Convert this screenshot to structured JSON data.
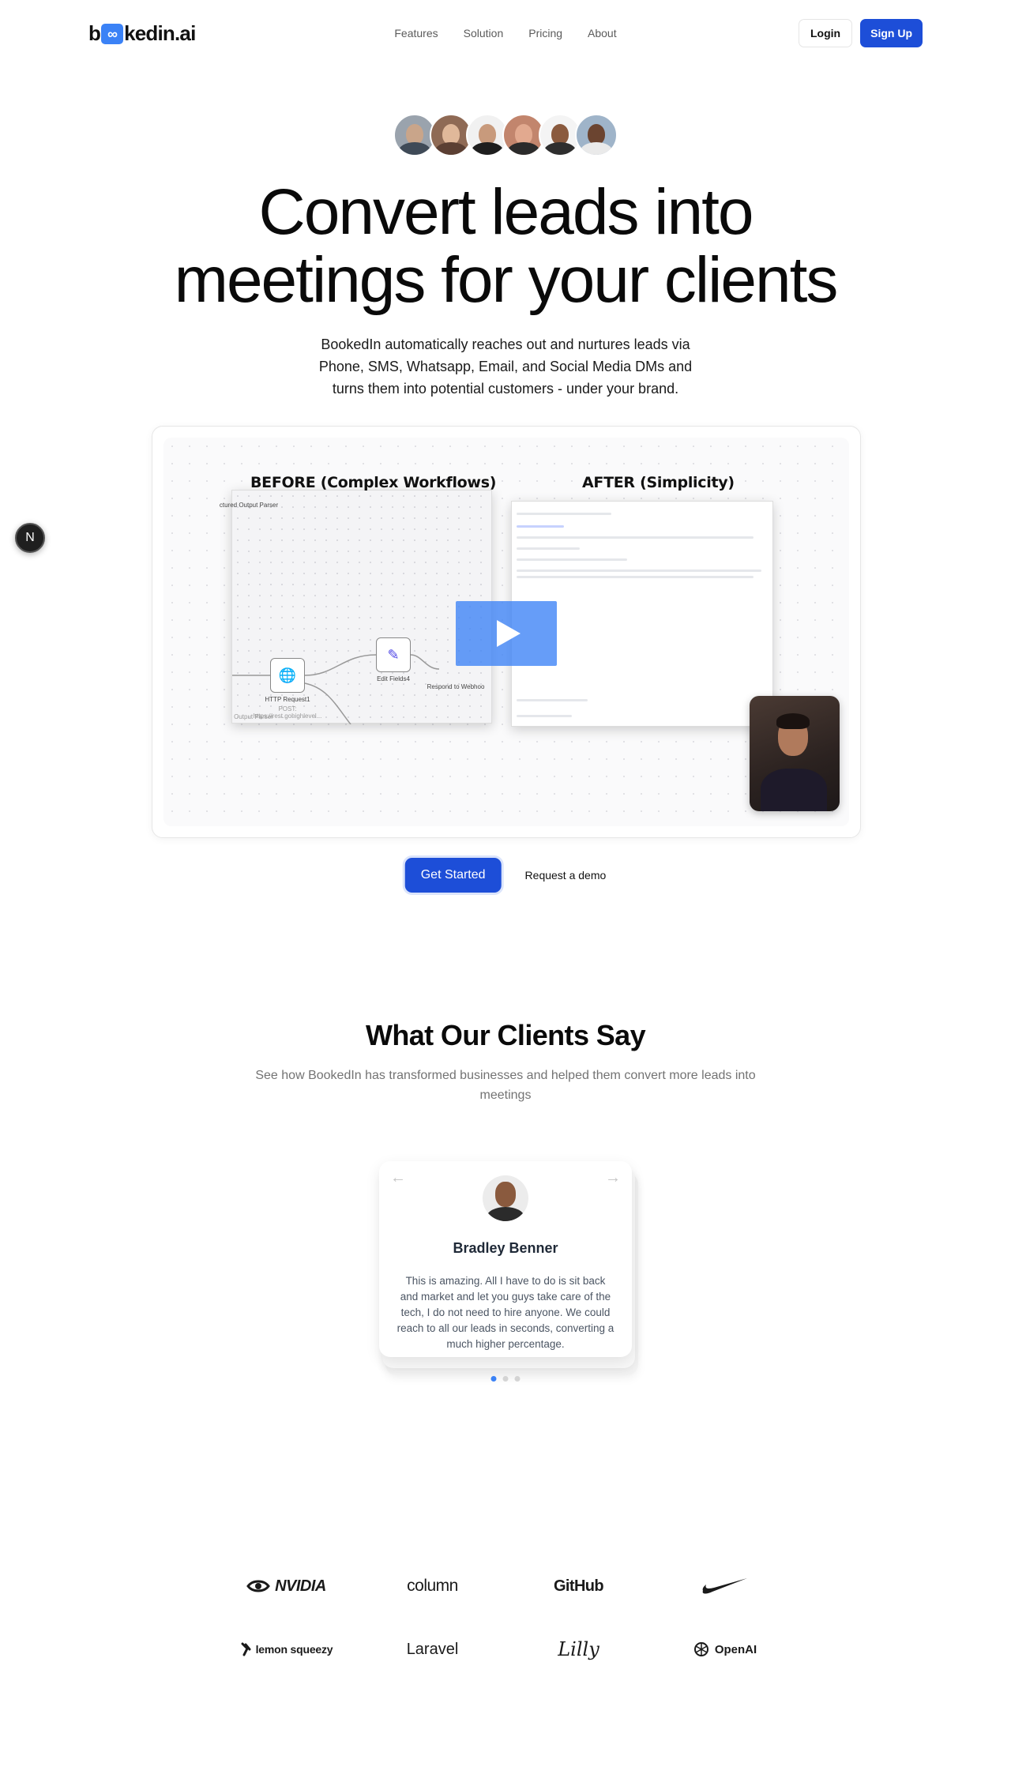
{
  "nav": {
    "logo_prefix": "b",
    "logo_mark": "∞",
    "logo_suffix": "kedin.ai",
    "links": [
      "Features",
      "Solution",
      "Pricing",
      "About"
    ],
    "login_label": "Login",
    "signup_label": "Sign Up"
  },
  "hero": {
    "title_line1": "Convert leads into",
    "title_line2": "meetings for your clients",
    "subtitle": "BookedIn automatically reaches out and nurtures leads via Phone, SMS, Whatsapp, Email, and Social Media DMs and turns them into potential customers - under your brand.",
    "avatar_colors": [
      "#6b7280",
      "#a57a5a",
      "#c89a7c",
      "#b5836a",
      "#7a4f3a",
      "#6b4430"
    ]
  },
  "video": {
    "before_label": "BEFORE (Complex Workflows)",
    "after_label": "AFTER (Simplicity)",
    "node_structured": "ctured Output Parser",
    "node_http": "HTTP Request1",
    "node_http_sub": "POST: https://rest.gohighlevel...",
    "node_edit": "Edit Fields4",
    "node_respond": "Respond to Webhoo",
    "node_outputs": "Output Parser",
    "side_widget": "N",
    "play_icon": "play-icon"
  },
  "cta": {
    "primary_label": "Get Started",
    "secondary_label": "Request a demo"
  },
  "testimonials": {
    "title": "What Our Clients Say",
    "subtitle": "See how BookedIn has transformed businesses and helped them convert more leads into meetings",
    "prev_arrow": "←",
    "next_arrow": "→",
    "name": "Bradley Benner",
    "quote": "This is amazing. All I have to do is sit back and market and let you guys take care of the tech, I do not need to hire anyone. We could reach to all our leads in seconds, converting a much higher percentage.",
    "active_dot": 0
  },
  "logos": {
    "nvidia": "NVIDIA",
    "column": "column",
    "github": "GitHub",
    "nike": "nike-swoosh",
    "lemon": "lemon squeezy",
    "laravel": "Laravel",
    "lilly": "Lilly",
    "openai": "OpenAI"
  },
  "colors": {
    "accent": "#1d4ed8",
    "play_overlay": "#3b82f6"
  }
}
